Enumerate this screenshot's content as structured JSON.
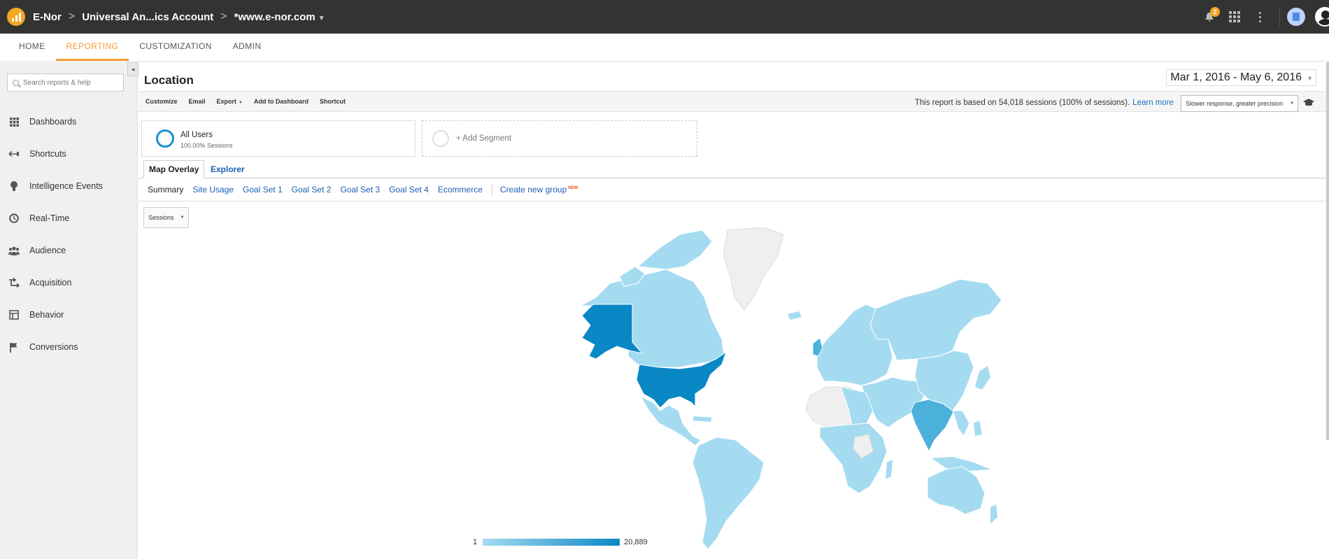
{
  "breadcrumb": {
    "org": "E-Nor",
    "account": "Universal An...ics Account",
    "property": "*www.e-nor.com",
    "separator": ">"
  },
  "notifications": {
    "count": "2"
  },
  "navtabs": [
    {
      "label": "HOME",
      "active": false
    },
    {
      "label": "REPORTING",
      "active": true
    },
    {
      "label": "CUSTOMIZATION",
      "active": false
    },
    {
      "label": "ADMIN",
      "active": false
    }
  ],
  "sidebar": {
    "collapse_glyph": "◂",
    "search_placeholder": "Search reports & help",
    "items": [
      {
        "label": "Dashboards",
        "icon": "grid-icon"
      },
      {
        "label": "Shortcuts",
        "icon": "arrow-left-icon"
      },
      {
        "label": "Intelligence Events",
        "icon": "lightbulb-icon"
      },
      {
        "label": "Real-Time",
        "icon": "clock-icon"
      },
      {
        "label": "Audience",
        "icon": "people-icon"
      },
      {
        "label": "Acquisition",
        "icon": "acquisition-icon"
      },
      {
        "label": "Behavior",
        "icon": "behavior-icon"
      },
      {
        "label": "Conversions",
        "icon": "flag-icon"
      }
    ]
  },
  "report": {
    "title": "Location",
    "date_range": "Mar 1, 2016 - May 6, 2016",
    "toolbar": [
      "Customize",
      "Email",
      "Export",
      "Add to Dashboard",
      "Shortcut"
    ],
    "sampling_text": "This report is based on 54,018 sessions (100% of sessions).",
    "learn_more": "Learn more",
    "precision": "Slower response, greater precision"
  },
  "segments": {
    "active": {
      "name": "All Users",
      "sub": "100.00% Sessions"
    },
    "add_label": "+ Add Segment"
  },
  "view_tabs": [
    {
      "label": "Map Overlay",
      "active": true
    },
    {
      "label": "Explorer",
      "active": false
    }
  ],
  "metric_groups": [
    {
      "label": "Summary",
      "active": true
    },
    {
      "label": "Site Usage",
      "active": false
    },
    {
      "label": "Goal Set 1",
      "active": false
    },
    {
      "label": "Goal Set 2",
      "active": false
    },
    {
      "label": "Goal Set 3",
      "active": false
    },
    {
      "label": "Goal Set 4",
      "active": false
    },
    {
      "label": "Ecommerce",
      "active": false
    }
  ],
  "create_group": {
    "label": "Create new group",
    "badge": "NEW"
  },
  "metric_select": "Sessions",
  "legend": {
    "min": "1",
    "max": "20,889"
  },
  "colors": {
    "accent": "#f49d35",
    "link": "#1a5fb4",
    "map_high": "#0a87c5",
    "map_mid": "#4bb1db",
    "map_low": "#a5dbf0",
    "map_none": "#efefef"
  }
}
